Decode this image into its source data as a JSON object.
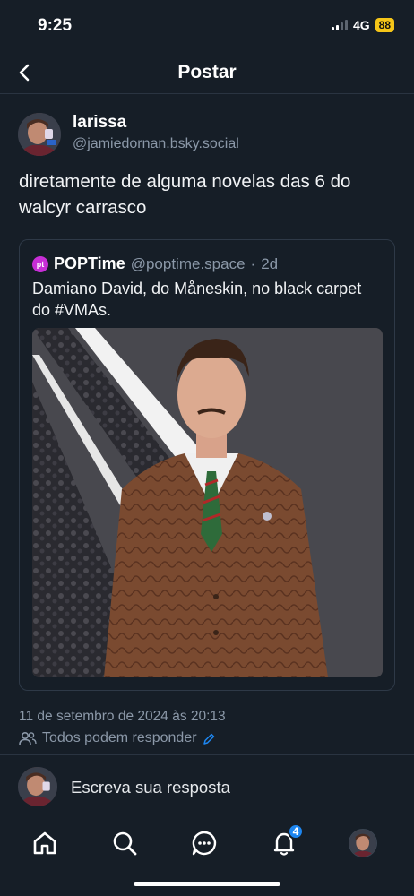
{
  "status_bar": {
    "time": "9:25",
    "network": "4G",
    "battery": "88"
  },
  "header": {
    "title": "Postar",
    "back_icon": "chevron-left-icon"
  },
  "post": {
    "author_name": "larissa",
    "author_handle": "@jamiedornan.bsky.social",
    "text": "diretamente de alguma novelas das 6 do walcyr carrasco",
    "date": "11 de setembro de 2024 às 20:13",
    "reply_setting": "Todos podem responder"
  },
  "quote": {
    "avatar_text": "pt",
    "author_name": "POPTime",
    "author_handle": "@poptime.space",
    "separator": "·",
    "time": "2d",
    "text": "Damiano David, do Måneskin, no black carpet do #VMAs."
  },
  "reply": {
    "placeholder": "Escreva sua resposta"
  },
  "nav": {
    "items": [
      {
        "name": "home",
        "icon": "home-icon"
      },
      {
        "name": "search",
        "icon": "search-icon"
      },
      {
        "name": "chat",
        "icon": "chat-icon"
      },
      {
        "name": "notifications",
        "icon": "bell-icon",
        "badge": "4"
      },
      {
        "name": "profile",
        "icon": "avatar"
      }
    ]
  },
  "colors": {
    "background": "#161e27",
    "accent": "#1d86f0",
    "muted": "#8b98a8",
    "battery": "#f5c518",
    "quote_avatar": "#c72ed6"
  }
}
